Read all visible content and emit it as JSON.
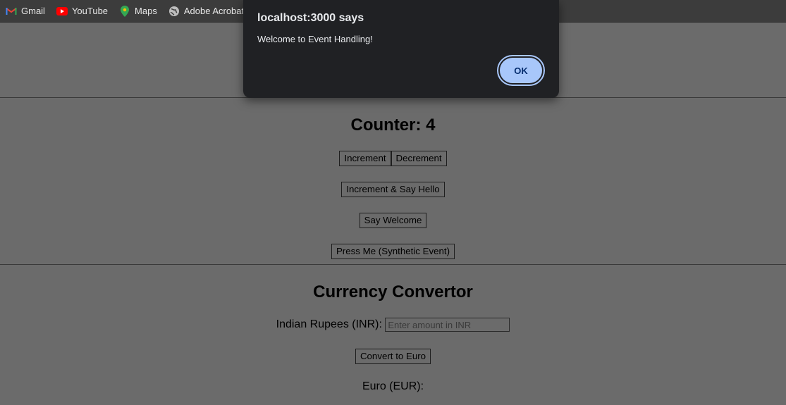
{
  "bookmarks": [
    {
      "label": "Gmail",
      "icon": "gmail-icon"
    },
    {
      "label": "YouTube",
      "icon": "youtube-icon"
    },
    {
      "label": "Maps",
      "icon": "maps-icon"
    },
    {
      "label": "Adobe Acrobat",
      "icon": "globe-icon"
    }
  ],
  "counter": {
    "title": "Counter: 4",
    "increment_label": "Increment",
    "decrement_label": "Decrement",
    "increment_hello_label": "Increment & Say Hello",
    "say_welcome_label": "Say Welcome",
    "press_me_label": "Press Me (Synthetic Event)"
  },
  "converter": {
    "title": "Currency Convertor",
    "inr_label": "Indian Rupees (INR):",
    "inr_placeholder": "Enter amount in INR",
    "convert_label": "Convert to Euro",
    "eur_label": "Euro (EUR):"
  },
  "alert": {
    "title": "localhost:3000 says",
    "message": "Welcome to Event Handling!",
    "ok_label": "OK"
  }
}
